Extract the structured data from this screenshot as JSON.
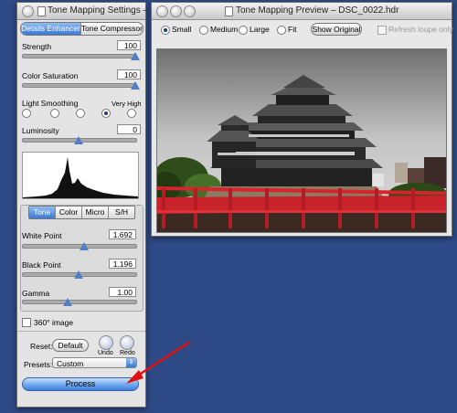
{
  "settings_window": {
    "title": "Tone Mapping Settings – D...",
    "tabs": [
      "Details Enhancer",
      "Tone Compressor"
    ],
    "active_tab": 0,
    "strength": {
      "label": "Strength",
      "value": "100",
      "level": 1.0
    },
    "color_saturation": {
      "label": "Color Saturation",
      "value": "100",
      "level": 1.0
    },
    "light_smoothing": {
      "label": "Light Smoothing",
      "max_label": "Very High",
      "selected_index": 3,
      "levels": 5
    },
    "luminosity": {
      "label": "Luminosity",
      "value": "0",
      "level": 0.5
    },
    "subtabs": [
      "Tone",
      "Color",
      "Micro",
      "S/H"
    ],
    "active_subtab": 0,
    "white_point": {
      "label": "White Point",
      "value": "1.692",
      "level": 0.55
    },
    "black_point": {
      "label": "Black Point",
      "value": "1.196",
      "level": 0.5
    },
    "gamma": {
      "label": "Gamma",
      "value": "1.00",
      "level": 0.4
    },
    "image_360_label": "360° image",
    "reset_label": "Reset:",
    "default_label": "Default",
    "undo_label": "Undo",
    "redo_label": "Redo",
    "presets_label": "Presets:",
    "presets_value": "Custom",
    "process_label": "Process"
  },
  "preview_window": {
    "title": "Tone Mapping Preview – DSC_0022.hdr",
    "sizes": [
      "Small",
      "Medium",
      "Large",
      "Fit"
    ],
    "selected_size": 0,
    "show_original_label": "Show Original",
    "refresh_loupe_label": "Refresh loupe only"
  },
  "colors": {
    "desktop": "#2e4a86",
    "accent_blue": "#3a78d4",
    "annotation_arrow": "#e01010"
  },
  "icons": {
    "arrow": "red-arrow-icon",
    "castle": "castle-photo"
  }
}
